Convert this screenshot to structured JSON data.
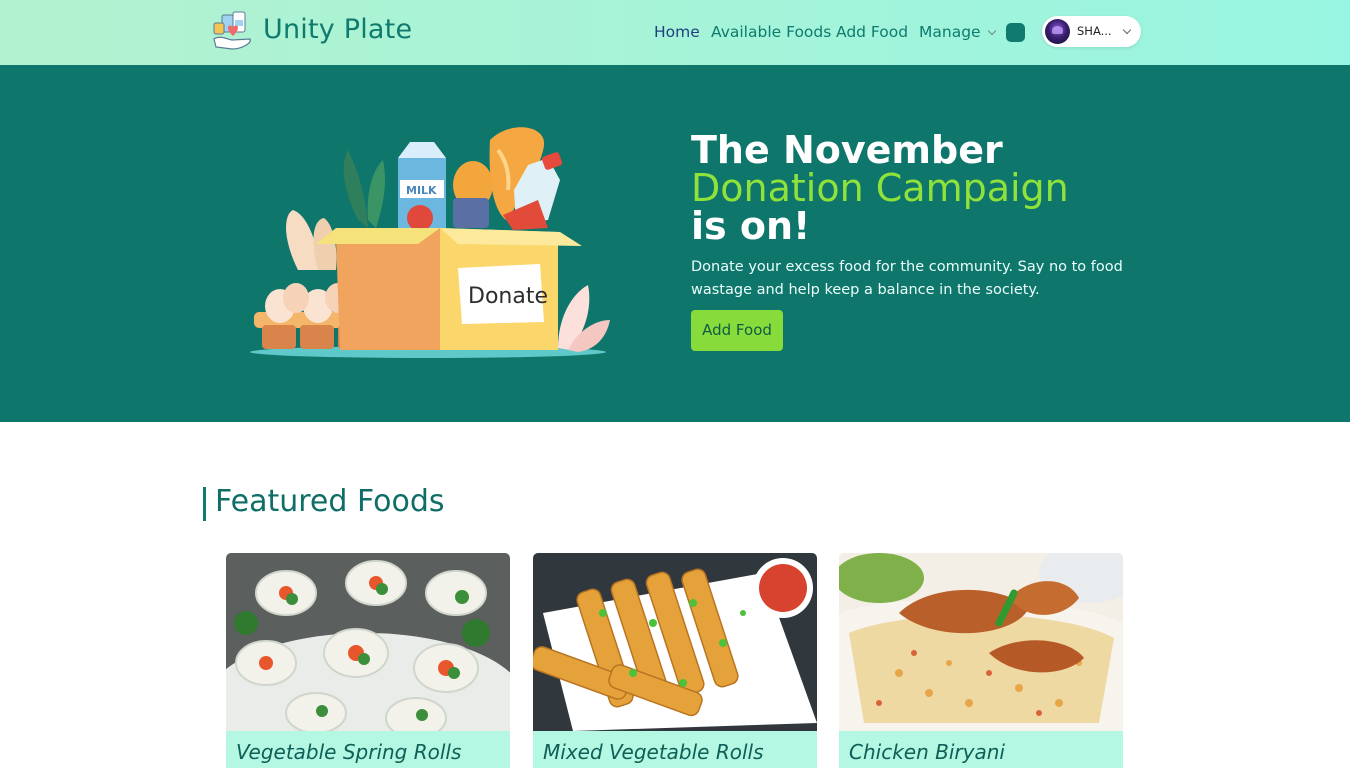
{
  "brand": {
    "name": "Unity Plate",
    "logo_icon": "food-donation-logo-icon"
  },
  "nav": {
    "items": [
      {
        "label": "Home",
        "active": true
      },
      {
        "label": "Available Foods"
      },
      {
        "label": "Add Food"
      },
      {
        "label": "Manage"
      }
    ],
    "theme_toggle_icon": "theme-toggle-icon",
    "user": {
      "name": "SHA..."
    }
  },
  "hero": {
    "title_line1": "The November",
    "title_line2": "Donation Campaign",
    "title_line3": "is on!",
    "subtitle": "Donate your excess food for the community. Say no to food wastage and help keep a balance in the society.",
    "button_label": "Add Food",
    "illustration_label": "Donate",
    "colors": {
      "bg": "#0f766c",
      "accent": "#8fe23a"
    }
  },
  "featured": {
    "heading": "Featured Foods",
    "cards": [
      {
        "title": "Vegetable Spring Rolls",
        "image_icon": "spring-rolls-photo"
      },
      {
        "title": "Mixed Vegetable Rolls",
        "image_icon": "vegetable-rolls-photo"
      },
      {
        "title": "Chicken Biryani",
        "image_icon": "chicken-biryani-photo"
      }
    ]
  }
}
